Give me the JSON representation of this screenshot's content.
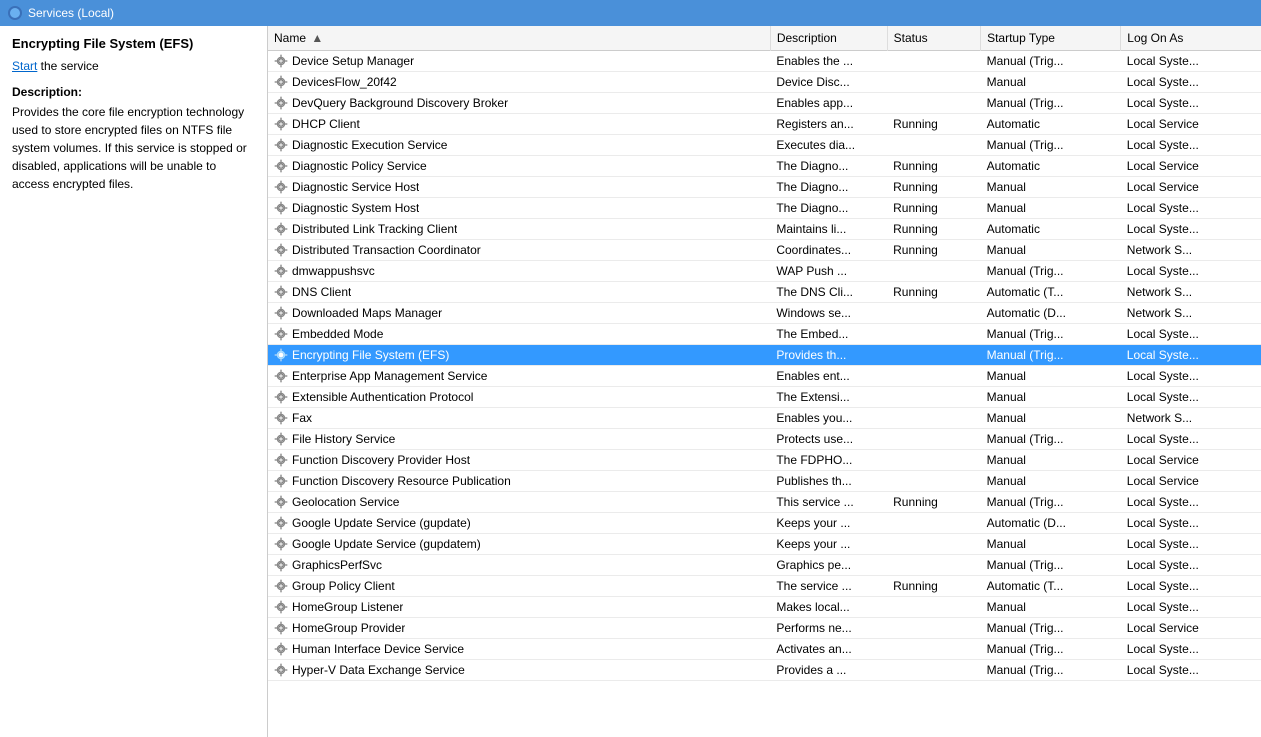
{
  "titleBar": {
    "icon": "services-icon",
    "label": "Services (Local)"
  },
  "leftPanel": {
    "serviceTitle": "Encrypting File System (EFS)",
    "startLinkText": "Start",
    "startLinkSuffix": " the service",
    "descriptionLabel": "Description:",
    "descriptionText": "Provides the core file encryption technology used to store encrypted files on NTFS file system volumes. If this service is stopped or disabled, applications will be unable to access encrypted files."
  },
  "tableHeaders": {
    "name": "Name",
    "nameArrow": "▲",
    "description": "Description",
    "status": "Status",
    "startupType": "Startup Type",
    "logOnAs": "Log On As"
  },
  "services": [
    {
      "name": "Device Setup Manager",
      "description": "Enables the ...",
      "status": "",
      "startupType": "Manual (Trig...",
      "logOnAs": "Local Syste..."
    },
    {
      "name": "DevicesFlow_20f42",
      "description": "Device Disc...",
      "status": "",
      "startupType": "Manual",
      "logOnAs": "Local Syste..."
    },
    {
      "name": "DevQuery Background Discovery Broker",
      "description": "Enables app...",
      "status": "",
      "startupType": "Manual (Trig...",
      "logOnAs": "Local Syste..."
    },
    {
      "name": "DHCP Client",
      "description": "Registers an...",
      "status": "Running",
      "startupType": "Automatic",
      "logOnAs": "Local Service"
    },
    {
      "name": "Diagnostic Execution Service",
      "description": "Executes dia...",
      "status": "",
      "startupType": "Manual (Trig...",
      "logOnAs": "Local Syste..."
    },
    {
      "name": "Diagnostic Policy Service",
      "description": "The Diagno...",
      "status": "Running",
      "startupType": "Automatic",
      "logOnAs": "Local Service"
    },
    {
      "name": "Diagnostic Service Host",
      "description": "The Diagno...",
      "status": "Running",
      "startupType": "Manual",
      "logOnAs": "Local Service"
    },
    {
      "name": "Diagnostic System Host",
      "description": "The Diagno...",
      "status": "Running",
      "startupType": "Manual",
      "logOnAs": "Local Syste..."
    },
    {
      "name": "Distributed Link Tracking Client",
      "description": "Maintains li...",
      "status": "Running",
      "startupType": "Automatic",
      "logOnAs": "Local Syste..."
    },
    {
      "name": "Distributed Transaction Coordinator",
      "description": "Coordinates...",
      "status": "Running",
      "startupType": "Manual",
      "logOnAs": "Network S..."
    },
    {
      "name": "dmwappushsvc",
      "description": "WAP Push ...",
      "status": "",
      "startupType": "Manual (Trig...",
      "logOnAs": "Local Syste..."
    },
    {
      "name": "DNS Client",
      "description": "The DNS Cli...",
      "status": "Running",
      "startupType": "Automatic (T...",
      "logOnAs": "Network S..."
    },
    {
      "name": "Downloaded Maps Manager",
      "description": "Windows se...",
      "status": "",
      "startupType": "Automatic (D...",
      "logOnAs": "Network S..."
    },
    {
      "name": "Embedded Mode",
      "description": "The Embed...",
      "status": "",
      "startupType": "Manual (Trig...",
      "logOnAs": "Local Syste..."
    },
    {
      "name": "Encrypting File System (EFS)",
      "description": "Provides th...",
      "status": "",
      "startupType": "Manual (Trig...",
      "logOnAs": "Local Syste...",
      "selected": true
    },
    {
      "name": "Enterprise App Management Service",
      "description": "Enables ent...",
      "status": "",
      "startupType": "Manual",
      "logOnAs": "Local Syste..."
    },
    {
      "name": "Extensible Authentication Protocol",
      "description": "The Extensi...",
      "status": "",
      "startupType": "Manual",
      "logOnAs": "Local Syste..."
    },
    {
      "name": "Fax",
      "description": "Enables you...",
      "status": "",
      "startupType": "Manual",
      "logOnAs": "Network S..."
    },
    {
      "name": "File History Service",
      "description": "Protects use...",
      "status": "",
      "startupType": "Manual (Trig...",
      "logOnAs": "Local Syste..."
    },
    {
      "name": "Function Discovery Provider Host",
      "description": "The FDPHO...",
      "status": "",
      "startupType": "Manual",
      "logOnAs": "Local Service"
    },
    {
      "name": "Function Discovery Resource Publication",
      "description": "Publishes th...",
      "status": "",
      "startupType": "Manual",
      "logOnAs": "Local Service"
    },
    {
      "name": "Geolocation Service",
      "description": "This service ...",
      "status": "Running",
      "startupType": "Manual (Trig...",
      "logOnAs": "Local Syste..."
    },
    {
      "name": "Google Update Service (gupdate)",
      "description": "Keeps your ...",
      "status": "",
      "startupType": "Automatic (D...",
      "logOnAs": "Local Syste..."
    },
    {
      "name": "Google Update Service (gupdatem)",
      "description": "Keeps your ...",
      "status": "",
      "startupType": "Manual",
      "logOnAs": "Local Syste..."
    },
    {
      "name": "GraphicsPerfSvc",
      "description": "Graphics pe...",
      "status": "",
      "startupType": "Manual (Trig...",
      "logOnAs": "Local Syste..."
    },
    {
      "name": "Group Policy Client",
      "description": "The service ...",
      "status": "Running",
      "startupType": "Automatic (T...",
      "logOnAs": "Local Syste..."
    },
    {
      "name": "HomeGroup Listener",
      "description": "Makes local...",
      "status": "",
      "startupType": "Manual",
      "logOnAs": "Local Syste..."
    },
    {
      "name": "HomeGroup Provider",
      "description": "Performs ne...",
      "status": "",
      "startupType": "Manual (Trig...",
      "logOnAs": "Local Service"
    },
    {
      "name": "Human Interface Device Service",
      "description": "Activates an...",
      "status": "",
      "startupType": "Manual (Trig...",
      "logOnAs": "Local Syste..."
    },
    {
      "name": "Hyper-V Data Exchange Service",
      "description": "Provides a ...",
      "status": "",
      "startupType": "Manual (Trig...",
      "logOnAs": "Local Syste..."
    }
  ]
}
